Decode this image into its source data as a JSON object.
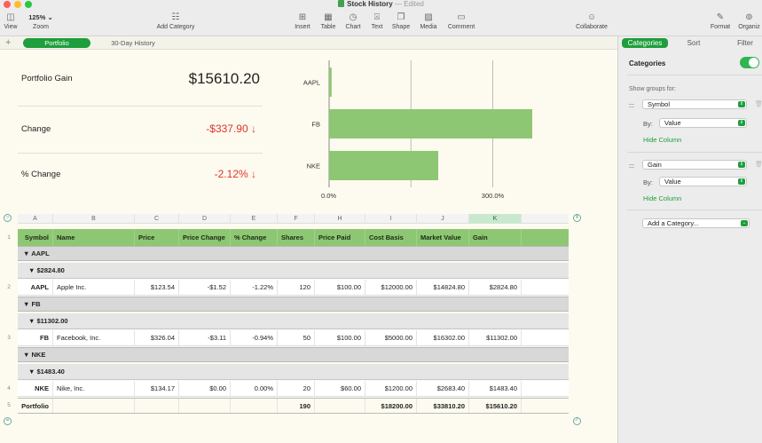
{
  "window": {
    "title": "Stock History",
    "edited": "— Edited"
  },
  "toolbar": {
    "view": "View",
    "zoom_value": "125%",
    "zoom": "Zoom",
    "add_category": "Add Category",
    "insert": "Insert",
    "table": "Table",
    "chart": "Chart",
    "text": "Text",
    "shape": "Shape",
    "media": "Media",
    "comment": "Comment",
    "collaborate": "Collaborate",
    "format": "Format",
    "organize": "Organiz"
  },
  "sheets": {
    "add": "+",
    "tabs": [
      "Portfolio",
      "30-Day History"
    ]
  },
  "summary": {
    "rows": [
      {
        "label": "Portfolio Gain",
        "value": "$15610.20"
      },
      {
        "label": "Change",
        "value": "-$337.90 ↓"
      },
      {
        "label": "% Change",
        "value": "-2.12% ↓"
      }
    ]
  },
  "chart_data": {
    "type": "bar",
    "orientation": "horizontal",
    "categories": [
      "AAPL",
      "FB",
      "NKE"
    ],
    "values": [
      4.6,
      432,
      200
    ],
    "xlim": [
      0,
      600
    ],
    "tick_labels": [
      "0.0%",
      "300.0%"
    ],
    "grid": true,
    "colors": {
      "bar": "#8ec773"
    }
  },
  "table": {
    "columns": [
      "A",
      "B",
      "C",
      "D",
      "E",
      "F",
      "H",
      "I",
      "J",
      "K"
    ],
    "row_numbers": [
      "1",
      "2",
      "3",
      "4",
      "5"
    ],
    "headers": [
      "Symbol",
      "Name",
      "Price",
      "Price Change",
      "% Change",
      "Shares",
      "Price Paid",
      "Cost Basis",
      "Market Value",
      "Gain"
    ],
    "groups": [
      {
        "symbol_group": "▼  AAPL",
        "gain_group": "▼  $2824.80",
        "row": [
          "AAPL",
          "Apple Inc.",
          "$123.54",
          "-$1.52",
          "-1.22%",
          "120",
          "$100.00",
          "$12000.00",
          "$14824.80",
          "$2824.80"
        ]
      },
      {
        "symbol_group": "▼  FB",
        "gain_group": "▼  $11302.00",
        "row": [
          "FB",
          "Facebook, Inc.",
          "$326.04",
          "-$3.11",
          "-0.94%",
          "50",
          "$100.00",
          "$5000.00",
          "$16302.00",
          "$11302.00"
        ]
      },
      {
        "symbol_group": "▼  NKE",
        "gain_group": "▼  $1483.40",
        "row": [
          "NKE",
          "Nike, Inc.",
          "$134.17",
          "$0.00",
          "0.00%",
          "20",
          "$60.00",
          "$1200.00",
          "$2683.40",
          "$1483.40"
        ]
      }
    ],
    "footer": [
      "Portfolio",
      "",
      "",
      "",
      "",
      "190",
      "",
      "$18200.00",
      "$33810.20",
      "$15610.20"
    ]
  },
  "sidebar": {
    "tabs": [
      "Categories",
      "Sort",
      "Filter"
    ],
    "heading": "Categories",
    "show_groups_for": "Show groups for:",
    "group1": {
      "field": "Symbol",
      "by_label": "By:",
      "by_value": "Value",
      "hide": "Hide Column"
    },
    "group2": {
      "field": "Gain",
      "by_label": "By:",
      "by_value": "Value",
      "hide": "Hide Column"
    },
    "add_category": "Add a Category..."
  },
  "colors": {
    "accent": "#1e9e3c",
    "header_row": "#8ec773",
    "negative": "#e0342a"
  }
}
